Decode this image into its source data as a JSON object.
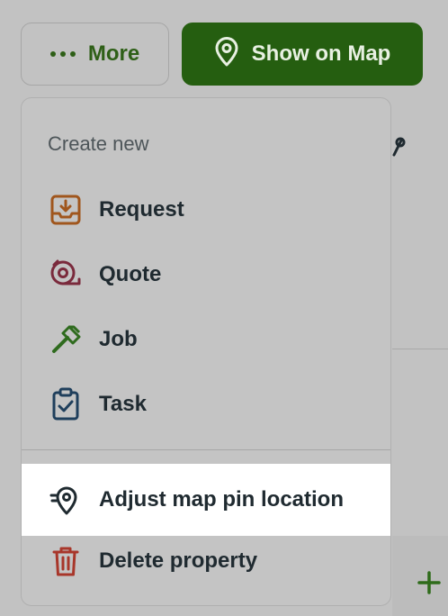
{
  "toolbar": {
    "more_label": "More",
    "show_on_map_label": "Show on Map"
  },
  "menu": {
    "heading": "Create new",
    "create_items": [
      {
        "label": "Request",
        "icon": "inbox-download-icon",
        "color": "#a0561d"
      },
      {
        "label": "Quote",
        "icon": "measuring-tape-icon",
        "color": "#7a2a3c"
      },
      {
        "label": "Job",
        "icon": "hammer-icon",
        "color": "#2f6b1e"
      },
      {
        "label": "Task",
        "icon": "clipboard-check-icon",
        "color": "#1f3f5c"
      }
    ],
    "action_items": [
      {
        "label": "Adjust map pin location",
        "icon": "map-pin-adjust-icon",
        "color": "#1f2a30",
        "highlighted": true
      },
      {
        "label": "Delete property",
        "icon": "trash-icon",
        "color": "#a8362a"
      }
    ]
  },
  "colors": {
    "primary_green": "#255e10",
    "text_dark": "#1f2a30",
    "highlight_bg": "#ffffff"
  }
}
